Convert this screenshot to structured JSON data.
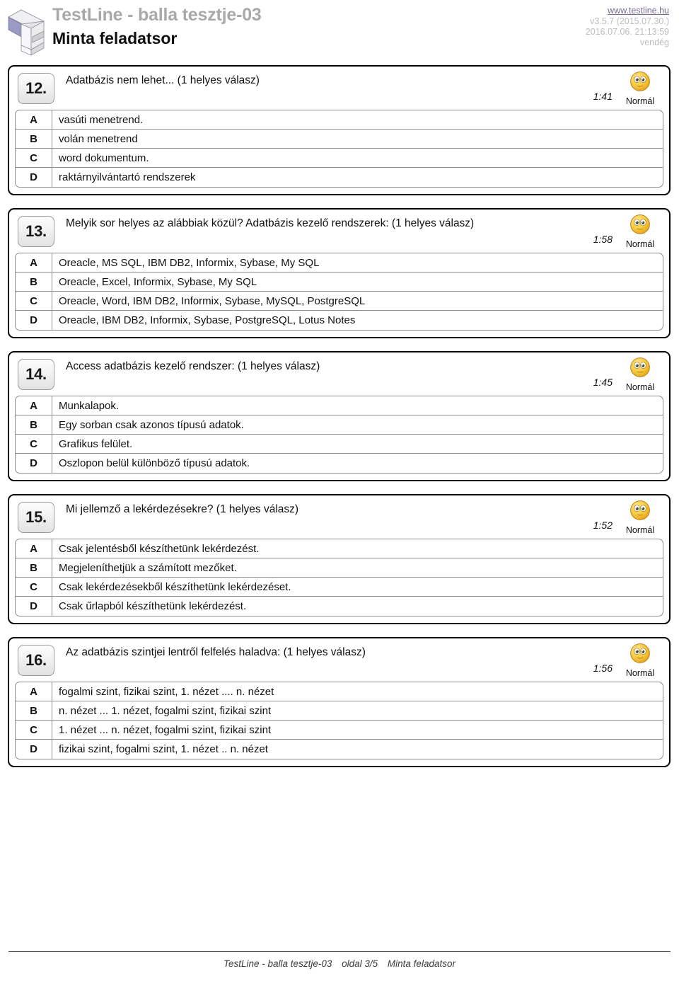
{
  "header": {
    "logo_icon": "testline-3d-block-logo",
    "title": "TestLine - balla tesztje-03",
    "subtitle": "Minta feladatsor",
    "site_url": "www.testline.hu",
    "version": "v3.5.7 (2015.07.30.)",
    "timestamp": "2016.07.06. 21:13:59",
    "user": "vendég"
  },
  "questions": [
    {
      "number": "12.",
      "text": "Adatbázis nem lehet... (1 helyes válasz)",
      "time": "1:41",
      "level": "Normál",
      "level_icon": "neutral-smiley-icon",
      "answers": [
        {
          "letter": "A",
          "text": "vasúti menetrend."
        },
        {
          "letter": "B",
          "text": "volán menetrend"
        },
        {
          "letter": "C",
          "text": "word dokumentum."
        },
        {
          "letter": "D",
          "text": "raktárnyilvántartó rendszerek"
        }
      ]
    },
    {
      "number": "13.",
      "text": "Melyik sor helyes az alábbiak közül? Adatbázis kezelő rendszerek: (1 helyes válasz)",
      "time": "1:58",
      "level": "Normál",
      "level_icon": "neutral-smiley-icon",
      "answers": [
        {
          "letter": "A",
          "text": "Oreacle, MS SQL, IBM DB2, Informix, Sybase, My SQL"
        },
        {
          "letter": "B",
          "text": "Oreacle, Excel, Informix, Sybase, My SQL"
        },
        {
          "letter": "C",
          "text": "Oreacle, Word, IBM DB2, Informix, Sybase, MySQL, PostgreSQL"
        },
        {
          "letter": "D",
          "text": "Oreacle, IBM DB2, Informix, Sybase, PostgreSQL, Lotus Notes"
        }
      ]
    },
    {
      "number": "14.",
      "text": "Access adatbázis kezelő rendszer: (1 helyes válasz)",
      "time": "1:45",
      "level": "Normál",
      "level_icon": "neutral-smiley-icon",
      "answers": [
        {
          "letter": "A",
          "text": "Munkalapok."
        },
        {
          "letter": "B",
          "text": "Egy sorban csak azonos típusú adatok."
        },
        {
          "letter": "C",
          "text": "Grafikus felület."
        },
        {
          "letter": "D",
          "text": "Oszlopon belül különböző típusú adatok."
        }
      ]
    },
    {
      "number": "15.",
      "text": "Mi jellemző a lekérdezésekre? (1 helyes válasz)",
      "time": "1:52",
      "level": "Normál",
      "level_icon": "neutral-smiley-icon",
      "answers": [
        {
          "letter": "A",
          "text": "Csak jelentésből készíthetünk lekérdezést."
        },
        {
          "letter": "B",
          "text": "Megjeleníthetjük a számított mezőket."
        },
        {
          "letter": "C",
          "text": "Csak lekérdezésekből készíthetünk lekérdezéset."
        },
        {
          "letter": "D",
          "text": "Csak űrlapból készíthetünk lekérdezést."
        }
      ]
    },
    {
      "number": "16.",
      "text": "Az adatbázis szintjei lentről felfelés haladva: (1 helyes válasz)",
      "time": "1:56",
      "level": "Normál",
      "level_icon": "neutral-smiley-icon",
      "answers": [
        {
          "letter": "A",
          "text": "fogalmi szint, fizikai szint, 1. nézet .... n. nézet"
        },
        {
          "letter": "B",
          "text": "n. nézet ... 1. nézet, fogalmi szint, fizikai szint"
        },
        {
          "letter": "C",
          "text": "1. nézet ... n. nézet, fogalmi szint, fizikai szint"
        },
        {
          "letter": "D",
          "text": "fizikai szint, fogalmi szint, 1. nézet .. n. nézet"
        }
      ]
    }
  ],
  "footer": {
    "test_name": "TestLine - balla tesztje-03",
    "page": "oldal 3/5",
    "sheet_name": "Minta feladatsor"
  },
  "colors": {
    "title_gray": "#a9a9a9",
    "link_purple": "#7a6e94",
    "meta_gray": "#bdbdbd",
    "smiley_yellow": "#f5c33b",
    "border_black": "#000000"
  }
}
